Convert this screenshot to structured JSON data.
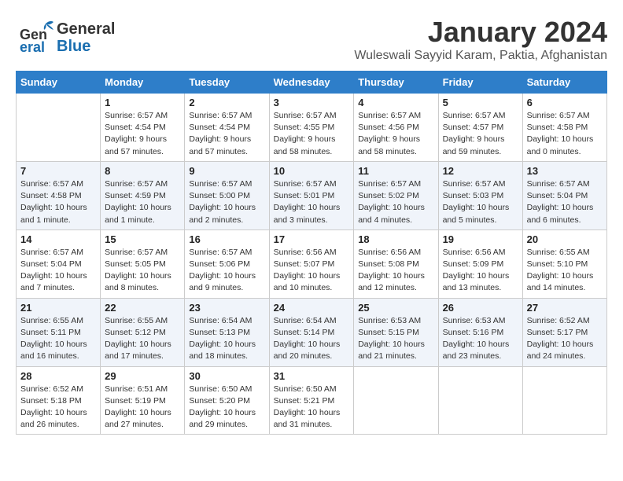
{
  "header": {
    "logo_general": "General",
    "logo_blue": "Blue",
    "month_title": "January 2024",
    "subtitle": "Wuleswali Sayyid Karam, Paktia, Afghanistan"
  },
  "days_of_week": [
    "Sunday",
    "Monday",
    "Tuesday",
    "Wednesday",
    "Thursday",
    "Friday",
    "Saturday"
  ],
  "weeks": [
    [
      {
        "day": "",
        "sunrise": "",
        "sunset": "",
        "daylight": ""
      },
      {
        "day": "1",
        "sunrise": "Sunrise: 6:57 AM",
        "sunset": "Sunset: 4:54 PM",
        "daylight": "Daylight: 9 hours and 57 minutes."
      },
      {
        "day": "2",
        "sunrise": "Sunrise: 6:57 AM",
        "sunset": "Sunset: 4:54 PM",
        "daylight": "Daylight: 9 hours and 57 minutes."
      },
      {
        "day": "3",
        "sunrise": "Sunrise: 6:57 AM",
        "sunset": "Sunset: 4:55 PM",
        "daylight": "Daylight: 9 hours and 58 minutes."
      },
      {
        "day": "4",
        "sunrise": "Sunrise: 6:57 AM",
        "sunset": "Sunset: 4:56 PM",
        "daylight": "Daylight: 9 hours and 58 minutes."
      },
      {
        "day": "5",
        "sunrise": "Sunrise: 6:57 AM",
        "sunset": "Sunset: 4:57 PM",
        "daylight": "Daylight: 9 hours and 59 minutes."
      },
      {
        "day": "6",
        "sunrise": "Sunrise: 6:57 AM",
        "sunset": "Sunset: 4:58 PM",
        "daylight": "Daylight: 10 hours and 0 minutes."
      }
    ],
    [
      {
        "day": "7",
        "sunrise": "Sunrise: 6:57 AM",
        "sunset": "Sunset: 4:58 PM",
        "daylight": "Daylight: 10 hours and 1 minute."
      },
      {
        "day": "8",
        "sunrise": "Sunrise: 6:57 AM",
        "sunset": "Sunset: 4:59 PM",
        "daylight": "Daylight: 10 hours and 1 minute."
      },
      {
        "day": "9",
        "sunrise": "Sunrise: 6:57 AM",
        "sunset": "Sunset: 5:00 PM",
        "daylight": "Daylight: 10 hours and 2 minutes."
      },
      {
        "day": "10",
        "sunrise": "Sunrise: 6:57 AM",
        "sunset": "Sunset: 5:01 PM",
        "daylight": "Daylight: 10 hours and 3 minutes."
      },
      {
        "day": "11",
        "sunrise": "Sunrise: 6:57 AM",
        "sunset": "Sunset: 5:02 PM",
        "daylight": "Daylight: 10 hours and 4 minutes."
      },
      {
        "day": "12",
        "sunrise": "Sunrise: 6:57 AM",
        "sunset": "Sunset: 5:03 PM",
        "daylight": "Daylight: 10 hours and 5 minutes."
      },
      {
        "day": "13",
        "sunrise": "Sunrise: 6:57 AM",
        "sunset": "Sunset: 5:04 PM",
        "daylight": "Daylight: 10 hours and 6 minutes."
      }
    ],
    [
      {
        "day": "14",
        "sunrise": "Sunrise: 6:57 AM",
        "sunset": "Sunset: 5:04 PM",
        "daylight": "Daylight: 10 hours and 7 minutes."
      },
      {
        "day": "15",
        "sunrise": "Sunrise: 6:57 AM",
        "sunset": "Sunset: 5:05 PM",
        "daylight": "Daylight: 10 hours and 8 minutes."
      },
      {
        "day": "16",
        "sunrise": "Sunrise: 6:57 AM",
        "sunset": "Sunset: 5:06 PM",
        "daylight": "Daylight: 10 hours and 9 minutes."
      },
      {
        "day": "17",
        "sunrise": "Sunrise: 6:56 AM",
        "sunset": "Sunset: 5:07 PM",
        "daylight": "Daylight: 10 hours and 10 minutes."
      },
      {
        "day": "18",
        "sunrise": "Sunrise: 6:56 AM",
        "sunset": "Sunset: 5:08 PM",
        "daylight": "Daylight: 10 hours and 12 minutes."
      },
      {
        "day": "19",
        "sunrise": "Sunrise: 6:56 AM",
        "sunset": "Sunset: 5:09 PM",
        "daylight": "Daylight: 10 hours and 13 minutes."
      },
      {
        "day": "20",
        "sunrise": "Sunrise: 6:55 AM",
        "sunset": "Sunset: 5:10 PM",
        "daylight": "Daylight: 10 hours and 14 minutes."
      }
    ],
    [
      {
        "day": "21",
        "sunrise": "Sunrise: 6:55 AM",
        "sunset": "Sunset: 5:11 PM",
        "daylight": "Daylight: 10 hours and 16 minutes."
      },
      {
        "day": "22",
        "sunrise": "Sunrise: 6:55 AM",
        "sunset": "Sunset: 5:12 PM",
        "daylight": "Daylight: 10 hours and 17 minutes."
      },
      {
        "day": "23",
        "sunrise": "Sunrise: 6:54 AM",
        "sunset": "Sunset: 5:13 PM",
        "daylight": "Daylight: 10 hours and 18 minutes."
      },
      {
        "day": "24",
        "sunrise": "Sunrise: 6:54 AM",
        "sunset": "Sunset: 5:14 PM",
        "daylight": "Daylight: 10 hours and 20 minutes."
      },
      {
        "day": "25",
        "sunrise": "Sunrise: 6:53 AM",
        "sunset": "Sunset: 5:15 PM",
        "daylight": "Daylight: 10 hours and 21 minutes."
      },
      {
        "day": "26",
        "sunrise": "Sunrise: 6:53 AM",
        "sunset": "Sunset: 5:16 PM",
        "daylight": "Daylight: 10 hours and 23 minutes."
      },
      {
        "day": "27",
        "sunrise": "Sunrise: 6:52 AM",
        "sunset": "Sunset: 5:17 PM",
        "daylight": "Daylight: 10 hours and 24 minutes."
      }
    ],
    [
      {
        "day": "28",
        "sunrise": "Sunrise: 6:52 AM",
        "sunset": "Sunset: 5:18 PM",
        "daylight": "Daylight: 10 hours and 26 minutes."
      },
      {
        "day": "29",
        "sunrise": "Sunrise: 6:51 AM",
        "sunset": "Sunset: 5:19 PM",
        "daylight": "Daylight: 10 hours and 27 minutes."
      },
      {
        "day": "30",
        "sunrise": "Sunrise: 6:50 AM",
        "sunset": "Sunset: 5:20 PM",
        "daylight": "Daylight: 10 hours and 29 minutes."
      },
      {
        "day": "31",
        "sunrise": "Sunrise: 6:50 AM",
        "sunset": "Sunset: 5:21 PM",
        "daylight": "Daylight: 10 hours and 31 minutes."
      },
      {
        "day": "",
        "sunrise": "",
        "sunset": "",
        "daylight": ""
      },
      {
        "day": "",
        "sunrise": "",
        "sunset": "",
        "daylight": ""
      },
      {
        "day": "",
        "sunrise": "",
        "sunset": "",
        "daylight": ""
      }
    ]
  ]
}
